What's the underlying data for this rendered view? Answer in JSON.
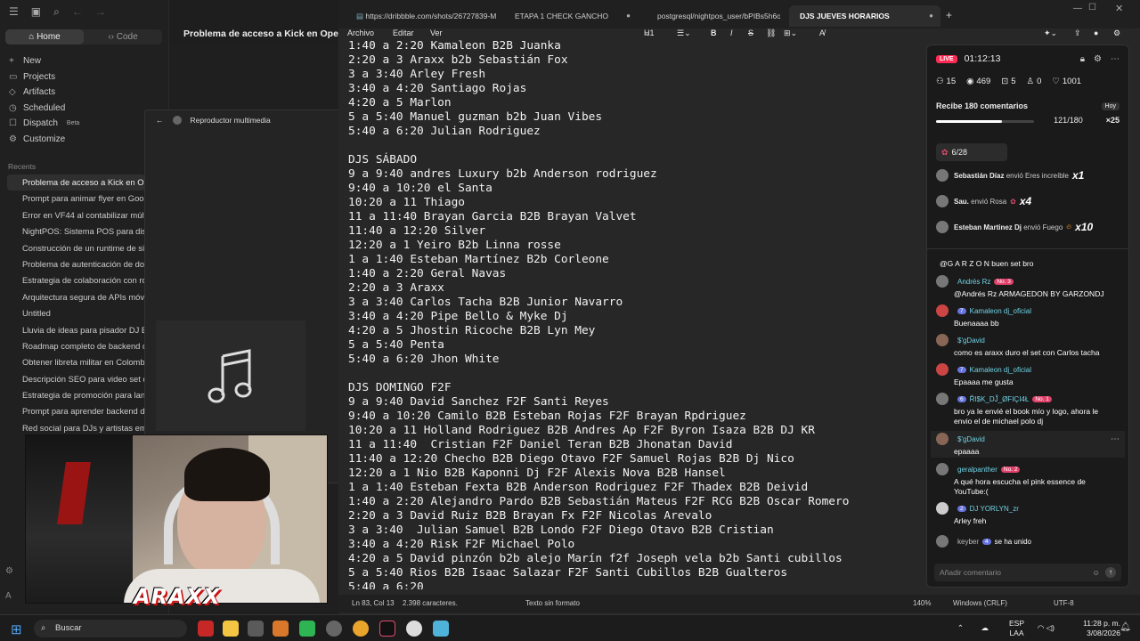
{
  "sidebar": {
    "tab_home": "Home",
    "tab_code": "Code",
    "nav": [
      {
        "label": "New",
        "icon": "+"
      },
      {
        "label": "Projects",
        "icon": "▭"
      },
      {
        "label": "Artifacts",
        "icon": "◇"
      },
      {
        "label": "Scheduled",
        "icon": "◷"
      },
      {
        "label": "Dispatch",
        "icon": "☐",
        "badge": "Beta"
      },
      {
        "label": "Customize",
        "icon": "⚙"
      }
    ],
    "recents_title": "Recents",
    "recents": [
      "Problema de acceso a Kick en Opera",
      "Prompt para animar flyer en Google",
      "Error en VF44 al contabilizar múltiples",
      "NightPOS: Sistema POS para discotecas",
      "Construcción de un runtime de sistema",
      "Problema de autenticación de dos factores",
      "Estrategia de colaboración con roles",
      "Arquitectura segura de APIs móviles",
      "Untitled",
      "Lluvia de ideas para pisador DJ B2B",
      "Roadmap completo de backend de",
      "Obtener libreta militar en Colombia",
      "Descripción SEO para video set de",
      "Estrategia de promoción para lanzamiento",
      "Prompt para aprender backend de",
      "Red social para DJs y artistas emergentes"
    ]
  },
  "chat": {
    "title": "Problema de acceso a Kick en Opera"
  },
  "player": {
    "title": "Reproductor multimedia"
  },
  "webcam": {
    "overlay_text": "ARAXX"
  },
  "notepad": {
    "tabs": [
      {
        "label": "https://dribbble.com/shots/26727839-M"
      },
      {
        "label": "ETAPA 1 CHECK GANCHO"
      },
      {
        "label": "postgresql/nightpos_user/bPIBs5h6oT"
      },
      {
        "label": "DJS JUEVES HORARIOS"
      }
    ],
    "menu": [
      "Archivo",
      "Editar",
      "Ver"
    ],
    "toolbar_heading": "H1",
    "lines": [
      "1:40 a 2:20 Kamaleon B2B Juanka",
      "2:20 a 3 Araxx b2b Sebastián Fox",
      "3 a 3:40 Arley Fresh",
      "3:40 a 4:20 Santiago Rojas",
      "4:20 a 5 Marlon",
      "5 a 5:40 Manuel guzman b2b Juan Vibes",
      "5:40 a 6:20 Julian Rodriguez",
      "",
      "DJS SÁBADO",
      "9 a 9:40 andres Luxury b2b Anderson rodriguez",
      "9:40 a 10:20 el Santa",
      "10:20 a 11 Thiago",
      "11 a 11:40 Brayan Garcia B2B Brayan Valvet",
      "11:40 a 12:20 Silver",
      "12:20 a 1 Yeiro B2b Linna rosse",
      "1 a 1:40 Esteban Martínez B2b Corleone",
      "1:40 a 2:20 Geral Navas",
      "2:20 a 3 Araxx",
      "3 a 3:40 Carlos Tacha B2B Junior Navarro",
      "3:40 a 4:20 Pipe Bello & Myke Dj",
      "4:20 a 5 Jhostin Ricoche B2B Lyn Mey",
      "5 a 5:40 Penta",
      "5:40 a 6:20 Jhon White",
      "",
      "DJS DOMINGO F2F",
      "9 a 9:40 David Sanchez F2F Santi Reyes",
      "9:40 a 10:20 Camilo B2B Esteban Rojas F2F Brayan Rpdriguez",
      "10:20 a 11 Holland Rodriguez B2B Andres Ap F2F Byron Isaza B2B DJ KR",
      "11 a 11:40  Cristian F2F Daniel Teran B2B Jhonatan David",
      "11:40 a 12:20 Checho B2B Diego Otavo F2F Samuel Rojas B2B Dj Nico",
      "12:20 a 1 Nio B2B Kaponni Dj F2F Alexis Nova B2B Hansel",
      "1 a 1:40 Esteban Fexta B2B Anderson Rodriguez F2F Thadex B2B Deivid",
      "1:40 a 2:20 Alejandro Pardo B2B Sebastián Mateus F2F RCG B2B Oscar Romero",
      "2:20 a 3 David Ruiz B2B Brayan Fx F2F Nicolas Arevalo",
      "3 a 3:40  Julian Samuel B2B Londo F2F Diego Otavo B2B Cristian",
      "3:40 a 4:20 Risk F2F Michael Polo",
      "4:20 a 5 David pinzón b2b alejo Marín f2f Joseph vela b2b Santi cubillos",
      "5 a 5:40 Rios B2B Isaac Salazar F2F Santi Cubillos B2B Gualteros",
      "5:40 a 6:20"
    ],
    "status": {
      "position": "Ln 83, Col 13",
      "chars": "2.398 caracteres.",
      "format": "Texto sin formato",
      "zoom": "140%",
      "eol": "Windows (CRLF)",
      "encoding": "UTF-8"
    }
  },
  "live": {
    "badge": "LIVE",
    "timer": "01:12:13",
    "stats": [
      {
        "icon": "users-icon",
        "value": "15"
      },
      {
        "icon": "eye-icon",
        "value": "469"
      },
      {
        "icon": "gift-icon",
        "value": "5"
      },
      {
        "icon": "person-icon",
        "value": "0"
      },
      {
        "icon": "heart-icon",
        "value": "1001"
      }
    ],
    "goal_title": "Recibe 180 comentarios",
    "goal_progress": "121/180",
    "goal_fraction": 0.67,
    "goal_today": "Hoy",
    "goal_reward": "×25",
    "rose_counter": "6/28",
    "gifts": [
      {
        "user": "Sebastián Díaz",
        "action": "envió Eres increíble",
        "mult": "x1"
      },
      {
        "user": "Sau.",
        "action": "envió Rosa",
        "mult": "x4"
      },
      {
        "user": "Esteban Martinez Dj",
        "action": "envió Fuego",
        "mult": "x10"
      }
    ],
    "comments": [
      {
        "user": "",
        "level": "",
        "badge": "",
        "text": "@G A R Z O N buen set bro"
      },
      {
        "user": "Andrés Rz",
        "level": "",
        "badge": "No. 3",
        "text": "@Andrés Rz ARMAGEDON BY GARZONDJ"
      },
      {
        "user": "Kamaleon dj_oficial",
        "level": "7",
        "badge": "",
        "text": "Buenaaaa bb"
      },
      {
        "user": "$'gDavid",
        "level": "",
        "badge": "",
        "text": "como es araxx duro el set con Carlos tacha"
      },
      {
        "user": "Kamaleon dj_oficial",
        "level": "7",
        "badge": "",
        "text": "Epaaaa me gusta"
      },
      {
        "user": "ŘI$K_DĴ_ØFIÇI4Ł",
        "level": "6",
        "badge": "No. 1",
        "text": "bro ya le envié el book mío y logo, ahora le envio el de michael polo dj"
      },
      {
        "user": "$'gDavid",
        "level": "",
        "badge": "",
        "text": "epaaaa"
      },
      {
        "user": "geralpanther",
        "level": "",
        "badge": "No. 2",
        "text": "A qué hora escucha el pink essence de YouTube:("
      },
      {
        "user": "DJ YORLYN_zr",
        "level": "2",
        "badge": "",
        "text": "Arley freh"
      },
      {
        "user": "keyber",
        "level": "4",
        "badge": "",
        "text": "se ha unido"
      }
    ],
    "input_placeholder": "Añadir comentario"
  },
  "taskbar": {
    "search_label": "Buscar",
    "lang": "ESP",
    "lang2": "LAA",
    "time": "11:28 p. m.",
    "date": "3/08/2026"
  }
}
